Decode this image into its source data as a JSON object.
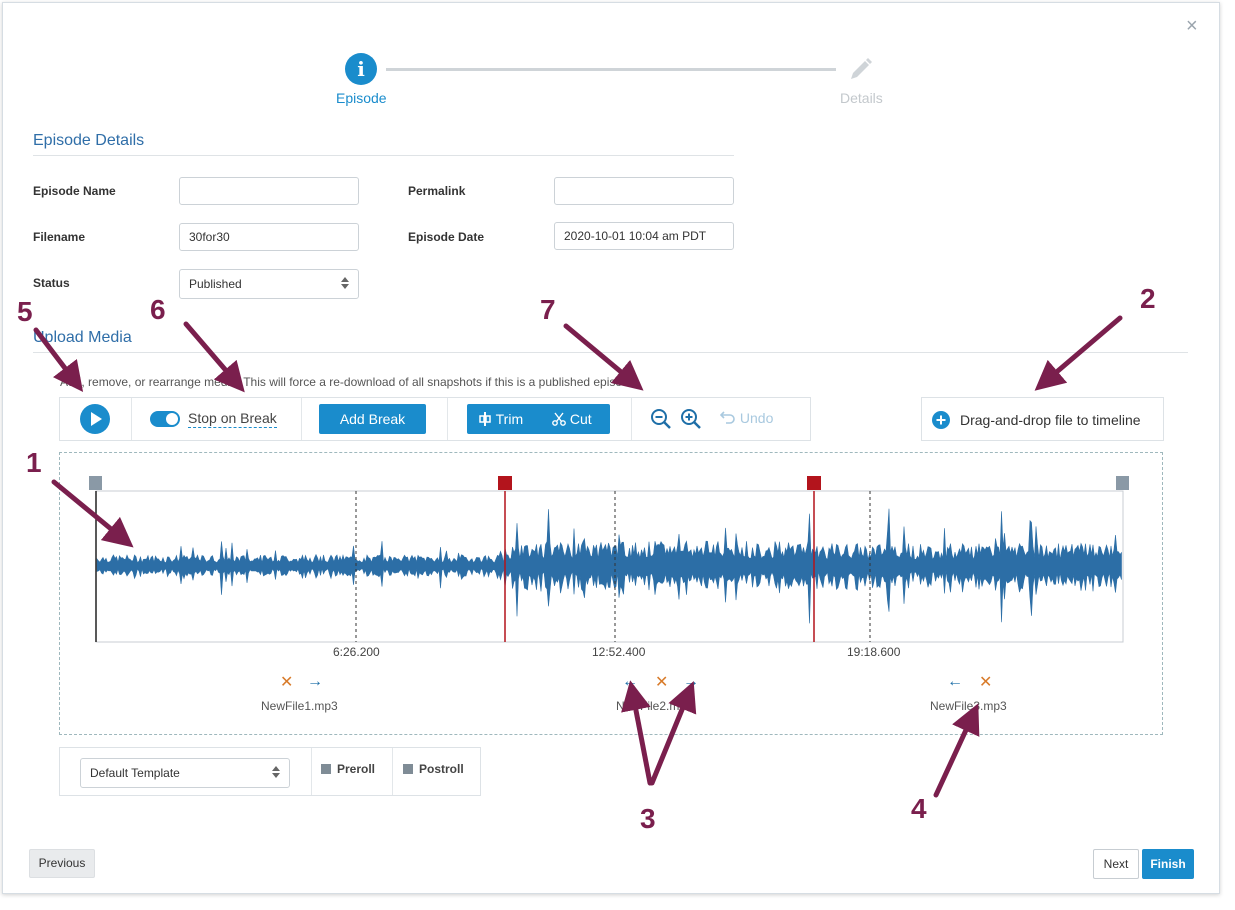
{
  "window": {
    "close_label": "×"
  },
  "steps": [
    {
      "label": "Episode",
      "icon": "info-icon",
      "glyph": "i",
      "active": true
    },
    {
      "label": "Details",
      "icon": "pencil-icon",
      "active": false
    }
  ],
  "episode_details": {
    "title": "Episode Details",
    "fields": {
      "episode_name": {
        "label": "Episode Name",
        "value": ""
      },
      "permalink": {
        "label": "Permalink",
        "value": ""
      },
      "filename": {
        "label": "Filename",
        "value": "30for30"
      },
      "episode_date": {
        "label": "Episode Date",
        "value": "2020-10-01 10:04 am PDT"
      },
      "status": {
        "label": "Status",
        "value": "Published"
      }
    }
  },
  "upload_media": {
    "title": "Upload Media",
    "note": "Add, remove, or rearrange media. This will force a re-download of all snapshots if this is a published episode.",
    "toolbar": {
      "play_icon": "play-icon",
      "stop_on_break_label": "Stop on Break",
      "stop_on_break_on": true,
      "add_break_label": "Add Break",
      "trim_label": "Trim",
      "cut_label": "Cut",
      "zoom_out_icon": "zoom-out-icon",
      "zoom_in_icon": "zoom-in-icon",
      "undo_label": "Undo"
    },
    "drag_drop_label": "Drag-and-drop file to timeline"
  },
  "timeline": {
    "ticks": [
      "6:26.200",
      "12:52.400",
      "19:18.600"
    ],
    "files": [
      {
        "name": "NewFile1.mp3",
        "controls": [
          "remove",
          "move-right"
        ]
      },
      {
        "name": "NewFile2.mp3",
        "controls": [
          "move-left",
          "remove",
          "move-right"
        ]
      },
      {
        "name": "NewFile3.mp3",
        "controls": [
          "move-left",
          "remove"
        ]
      }
    ],
    "colors": {
      "waveform": "#2c6ea6",
      "break": "#b3141c",
      "handle": "#8a99a6"
    }
  },
  "template": {
    "selected": "Default Template",
    "preroll_label": "Preroll",
    "postroll_label": "Postroll"
  },
  "footer": {
    "previous_label": "Previous",
    "next_label": "Next",
    "finish_label": "Finish"
  },
  "annotations": [
    "1",
    "2",
    "3",
    "4",
    "5",
    "6",
    "7"
  ],
  "colors": {
    "accent": "#1a8ccc",
    "annotation": "#7a1f4d"
  }
}
